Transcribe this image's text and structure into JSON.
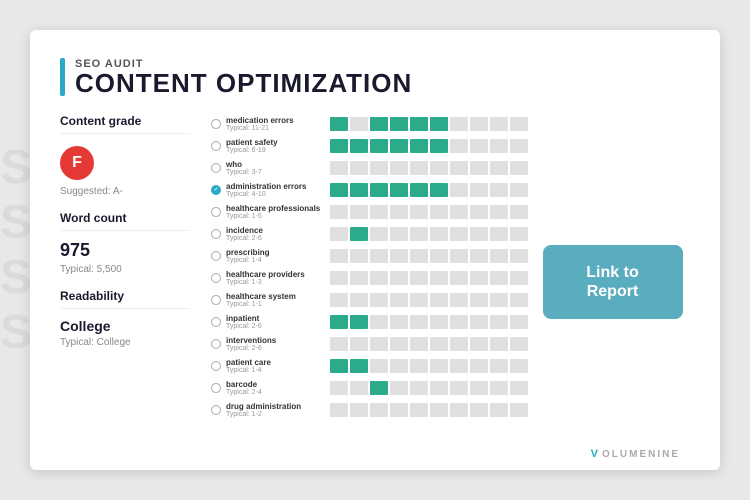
{
  "header": {
    "subtitle": "SEO Audit",
    "title": "Content Optimization",
    "bar_color": "#29a9c5"
  },
  "left_panel": {
    "content_grade_label": "Content grade",
    "grade_value": "F",
    "grade_suggested": "Suggested: A-",
    "word_count_label": "Word count",
    "word_count_value": "975",
    "word_count_typical": "Typical: 5,500",
    "readability_label": "Readability",
    "readability_value": "College",
    "readability_typical": "Typical: College"
  },
  "keywords": [
    {
      "name": "medication errors",
      "typical": "Typical: 11-21",
      "bars": [
        1,
        0,
        1,
        1,
        1,
        1
      ],
      "checked": false,
      "dot": true
    },
    {
      "name": "patient safety",
      "typical": "Typical: 6-19",
      "bars": [
        1,
        1,
        1,
        1,
        1,
        1
      ],
      "checked": false,
      "dot": false
    },
    {
      "name": "who",
      "typical": "Typical: 3-7",
      "bars": [
        0,
        0,
        0,
        0,
        0,
        0
      ],
      "checked": false,
      "dot": false
    },
    {
      "name": "administration errors",
      "typical": "Typical: 4-10",
      "bars": [
        1,
        1,
        1,
        1,
        1,
        1
      ],
      "checked": true,
      "dot": true
    },
    {
      "name": "healthcare professionals",
      "typical": "Typical: 1-5",
      "bars": [
        0,
        0,
        0,
        0,
        0,
        0
      ],
      "checked": false,
      "dot": false
    },
    {
      "name": "incidence",
      "typical": "Typical: 2-6",
      "bars": [
        0,
        1,
        0,
        0,
        0,
        0
      ],
      "checked": false,
      "dot": false
    },
    {
      "name": "prescribing",
      "typical": "Typical: 1-4",
      "bars": [
        0,
        0,
        0,
        0,
        0,
        0
      ],
      "checked": false,
      "dot": false
    },
    {
      "name": "healthcare providers",
      "typical": "Typical: 1-3",
      "bars": [
        0,
        0,
        0,
        0,
        0,
        0
      ],
      "checked": false,
      "dot": false
    },
    {
      "name": "healthcare system",
      "typical": "Typical: 1-1",
      "bars": [
        0,
        0,
        0,
        0,
        0,
        0
      ],
      "checked": false,
      "dot": false
    },
    {
      "name": "inpatient",
      "typical": "Typical: 2-6",
      "bars": [
        1,
        1,
        0,
        0,
        0,
        0
      ],
      "checked": false,
      "dot": false
    },
    {
      "name": "interventions",
      "typical": "Typical: 2-6",
      "bars": [
        0,
        0,
        0,
        0,
        0,
        0
      ],
      "checked": false,
      "dot": false
    },
    {
      "name": "patient care",
      "typical": "Typical: 1-4",
      "bars": [
        1,
        1,
        0,
        0,
        0,
        0
      ],
      "checked": false,
      "dot": false
    },
    {
      "name": "barcode",
      "typical": "Typical: 2-4",
      "bars": [
        0,
        0,
        1,
        0,
        0,
        0
      ],
      "checked": false,
      "dot": false
    },
    {
      "name": "drug administration",
      "typical": "Typical: 1-2",
      "bars": [
        0,
        0,
        0,
        0,
        0,
        0
      ],
      "checked": false,
      "dot": false
    }
  ],
  "link_button": {
    "label": "Link to Report"
  },
  "branding": {
    "text": "LUMENINE",
    "display": "V LUMENINE"
  },
  "colors": {
    "accent": "#29a9c5",
    "teal_bar": "#2baa8c",
    "grade_red": "#e53935",
    "button_teal": "#5aacbf"
  }
}
